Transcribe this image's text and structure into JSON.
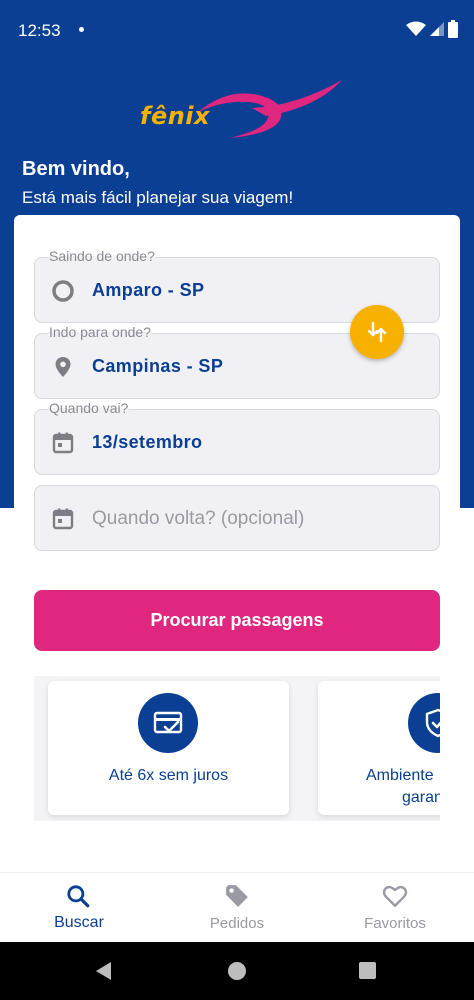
{
  "status_bar": {
    "time": "12:53"
  },
  "brand": {
    "logo_text": "fênix",
    "primary_color": "#0b3f93",
    "accent_color": "#e0267e",
    "highlight_color": "#f7b100"
  },
  "header": {
    "welcome": "Bem vindo,",
    "subtitle": "Está mais fácil planejar sua viagem!"
  },
  "form": {
    "origin": {
      "label": "Saindo de onde?",
      "value": "Amparo - SP",
      "icon": "origin-circle-icon"
    },
    "destination": {
      "label": "Indo para onde?",
      "value": "Campinas - SP",
      "icon": "location-pin-icon"
    },
    "departure": {
      "label": "Quando vai?",
      "value": "13/setembro",
      "icon": "calendar-icon"
    },
    "return": {
      "placeholder": "Quando volta? (opcional)",
      "icon": "calendar-icon"
    },
    "swap_icon": "swap-arrows-icon",
    "search_label": "Procurar passagens"
  },
  "features": [
    {
      "icon": "credit-card-check-icon",
      "text": "Até 6x sem juros"
    },
    {
      "icon": "shield-check-icon",
      "text_line1": "Ambiente",
      "text_line2": "garantido"
    }
  ],
  "bottom_nav": [
    {
      "icon": "search-icon",
      "label": "Buscar",
      "active": true
    },
    {
      "icon": "tag-icon",
      "label": "Pedidos",
      "active": false
    },
    {
      "icon": "heart-icon",
      "label": "Favoritos",
      "active": false
    }
  ]
}
